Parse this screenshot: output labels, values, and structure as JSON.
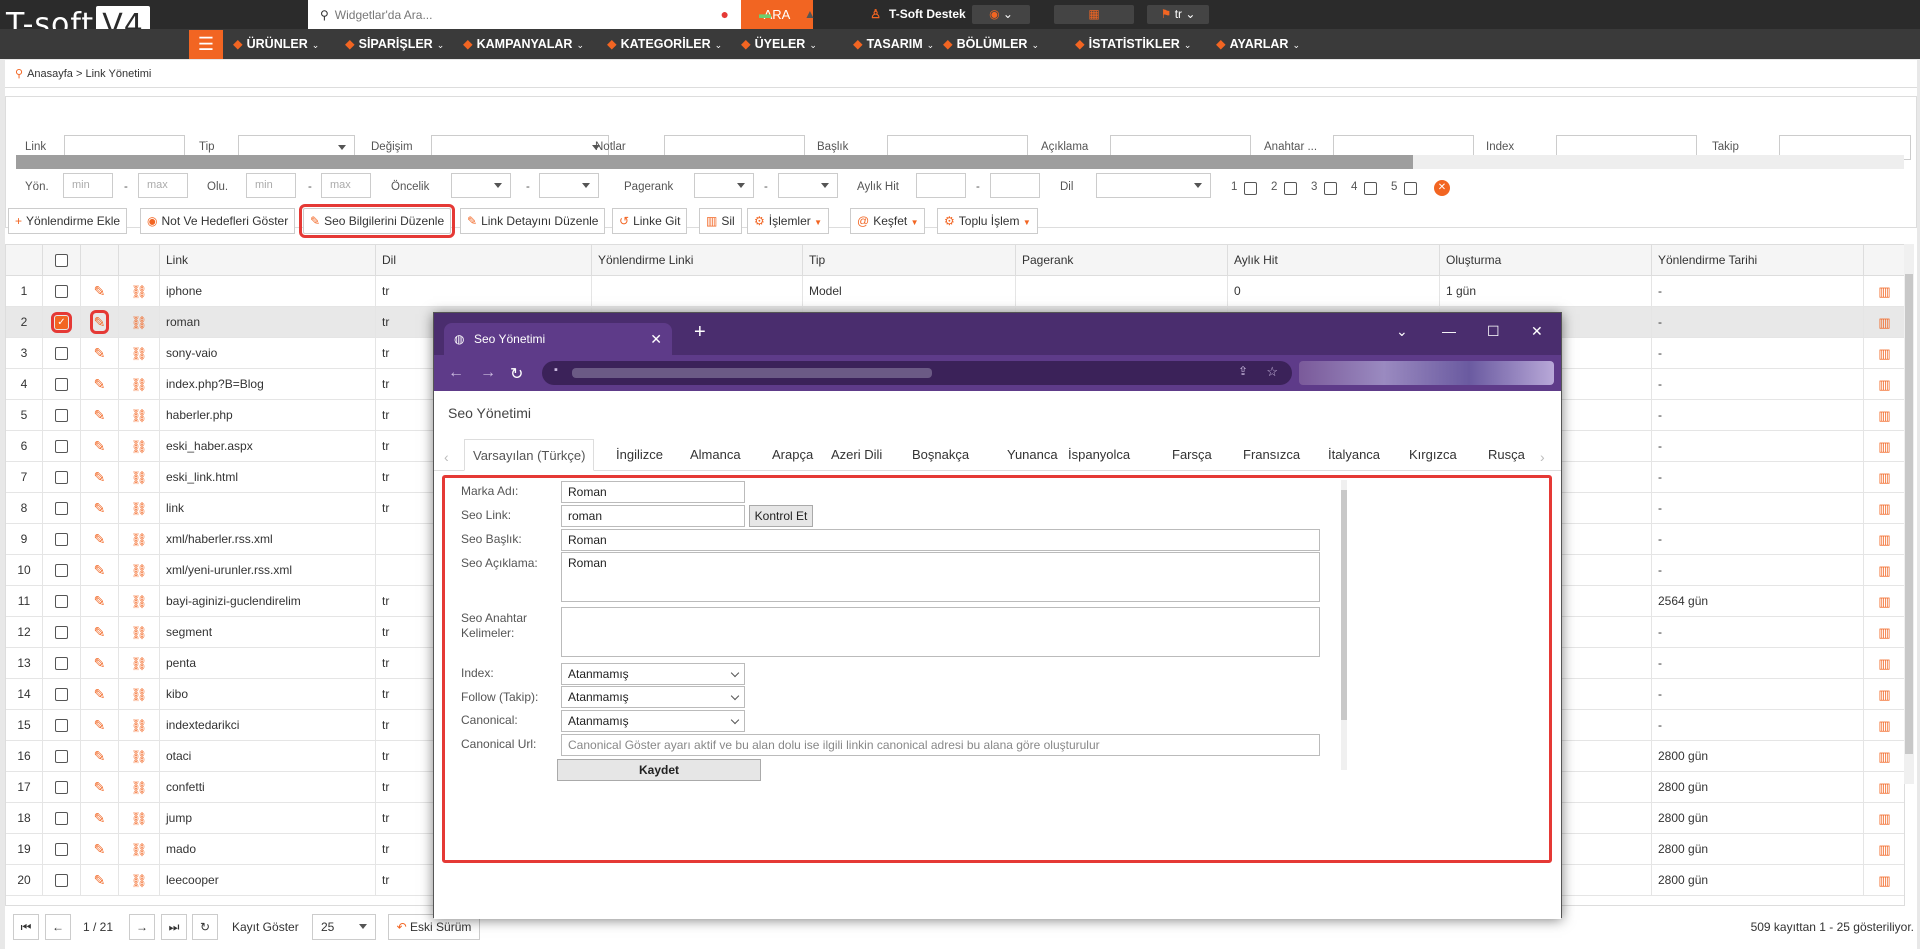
{
  "topbar": {
    "logo_text": "T-soft",
    "logo_badge": "V4",
    "search_placeholder": "Widgetlar'da Ara...",
    "search_button": "ARA",
    "support_label": "T-Soft Destek",
    "language": "tr"
  },
  "nav": {
    "items": [
      {
        "label": "ÜRÜNLER",
        "icon": "box-icon"
      },
      {
        "label": "SİPARİŞLER",
        "icon": "cart-icon"
      },
      {
        "label": "KAMPANYALAR",
        "icon": "tag-icon"
      },
      {
        "label": "KATEGORİLER",
        "icon": "sitemap-icon"
      },
      {
        "label": "ÜYELER",
        "icon": "users-icon"
      },
      {
        "label": "TASARIM",
        "icon": "brush-icon"
      },
      {
        "label": "BÖLÜMLER",
        "icon": "layers-icon"
      },
      {
        "label": "İSTATİSTİKLER",
        "icon": "chart-icon"
      },
      {
        "label": "AYARLAR",
        "icon": "settings-icon"
      }
    ]
  },
  "breadcrumb": "Anasayfa > Link Yönetimi",
  "filters": {
    "row1": [
      "Link",
      "Tip",
      "Değişim",
      "Notlar",
      "Başlık",
      "Açıklama",
      "Anahtar ...",
      "Index",
      "Takip"
    ],
    "row2": {
      "yon": "Yön.",
      "olu": "Olu.",
      "oncelik": "Öncelik",
      "pagerank": "Pagerank",
      "aylik_hit": "Aylık Hit",
      "dil": "Dil",
      "min": "min",
      "max": "max",
      "dash": "-",
      "checks": [
        "1",
        "2",
        "3",
        "4",
        "5"
      ]
    },
    "progress": 0.74
  },
  "toolbar": {
    "yonlendirme_ekle": "Yönlendirme Ekle",
    "not_goster": "Not Ve Hedefleri Göster",
    "seo_duzenle": "Seo Bilgilerini Düzenle",
    "link_detay": "Link Detayını Düzenle",
    "linke_git": "Linke Git",
    "sil": "Sil",
    "islemler": "İşlemler",
    "kesfet": "Keşfet",
    "toplu_islem": "Toplu İşlem"
  },
  "table": {
    "headers": [
      "Link",
      "Dil",
      "Yönlendirme Linki",
      "Tip",
      "Pagerank",
      "Aylık Hit",
      "Oluşturma",
      "Yönlendirme Tarihi"
    ],
    "rows": [
      {
        "n": "1",
        "link": "iphone",
        "dil": "tr",
        "tip": "Model",
        "hit": "0",
        "olus": "1 gün",
        "ytarih": "-"
      },
      {
        "n": "2",
        "link": "roman",
        "dil": "tr",
        "tip": "",
        "hit": "",
        "olus": "",
        "ytarih": "-"
      },
      {
        "n": "3",
        "link": "sony-vaio",
        "dil": "tr",
        "tip": "",
        "hit": "",
        "olus": "",
        "ytarih": "-"
      },
      {
        "n": "4",
        "link": "index.php?B=Blog",
        "dil": "tr",
        "tip": "",
        "hit": "",
        "olus": "",
        "ytarih": "-"
      },
      {
        "n": "5",
        "link": "haberler.php",
        "dil": "tr",
        "tip": "",
        "hit": "",
        "olus": "",
        "ytarih": "-"
      },
      {
        "n": "6",
        "link": "eski_haber.aspx",
        "dil": "tr",
        "tip": "",
        "hit": "",
        "olus": "",
        "ytarih": "-"
      },
      {
        "n": "7",
        "link": "eski_link.html",
        "dil": "tr",
        "tip": "",
        "hit": "",
        "olus": "",
        "ytarih": "-"
      },
      {
        "n": "8",
        "link": "link",
        "dil": "tr",
        "tip": "",
        "hit": "",
        "olus": "",
        "ytarih": "-"
      },
      {
        "n": "9",
        "link": "xml/haberler.rss.xml",
        "dil": "",
        "tip": "",
        "hit": "",
        "olus": "",
        "ytarih": "-"
      },
      {
        "n": "10",
        "link": "xml/yeni-urunler.rss.xml",
        "dil": "",
        "tip": "",
        "hit": "",
        "olus": "",
        "ytarih": "-"
      },
      {
        "n": "11",
        "link": "bayi-aginizi-guclendirelim",
        "dil": "tr",
        "tip": "",
        "hit": "",
        "olus": "",
        "ytarih": "2564 gün"
      },
      {
        "n": "12",
        "link": "segment",
        "dil": "tr",
        "tip": "",
        "hit": "",
        "olus": "",
        "ytarih": "-"
      },
      {
        "n": "13",
        "link": "penta",
        "dil": "tr",
        "tip": "",
        "hit": "",
        "olus": "",
        "ytarih": "-"
      },
      {
        "n": "14",
        "link": "kibo",
        "dil": "tr",
        "tip": "",
        "hit": "",
        "olus": "",
        "ytarih": "-"
      },
      {
        "n": "15",
        "link": "indextedarikci",
        "dil": "tr",
        "tip": "",
        "hit": "",
        "olus": "",
        "ytarih": "-"
      },
      {
        "n": "16",
        "link": "otaci",
        "dil": "tr",
        "tip": "",
        "hit": "",
        "olus": "",
        "ytarih": "2800 gün"
      },
      {
        "n": "17",
        "link": "confetti",
        "dil": "tr",
        "tip": "",
        "hit": "",
        "olus": "",
        "ytarih": "2800 gün"
      },
      {
        "n": "18",
        "link": "jump",
        "dil": "tr",
        "tip": "",
        "hit": "",
        "olus": "",
        "ytarih": "2800 gün"
      },
      {
        "n": "19",
        "link": "mado",
        "dil": "tr",
        "tip": "",
        "hit": "",
        "olus": "",
        "ytarih": "2800 gün"
      },
      {
        "n": "20",
        "link": "leecooper",
        "dil": "tr",
        "tip": "",
        "hit": "",
        "olus": "",
        "ytarih": "2800 gün"
      }
    ]
  },
  "footer": {
    "page": "1 / 21",
    "kayit_goster": "Kayıt Göster",
    "per_page": "25",
    "eski_surum": "Eski Sürüm",
    "summary": "509 kayıttan 1 - 25 gösteriliyor."
  },
  "popup": {
    "tab_title": "Seo Yönetimi",
    "heading": "Seo Yönetimi",
    "languages": [
      "Varsayılan (Türkçe)",
      "İngilizce",
      "Almanca",
      "Arapça",
      "Azeri Dili",
      "Boşnakça",
      "Yunanca",
      "İspanyolca",
      "Farsça",
      "Fransızca",
      "İtalyanca",
      "Kırgızca",
      "Rusça"
    ],
    "form": {
      "marka_label": "Marka Adı:",
      "marka_value": "Roman",
      "seo_link_label": "Seo Link:",
      "seo_link_value": "roman",
      "kontrol_btn": "Kontrol Et",
      "baslik_label": "Seo Başlık:",
      "baslik_value": "Roman",
      "aciklama_label": "Seo Açıklama:",
      "aciklama_value": "Roman",
      "anahtar_label": "Seo Anahtar Kelimeler:",
      "anahtar_value": "",
      "index_label": "Index:",
      "index_value": "Atanmamış",
      "follow_label": "Follow (Takip):",
      "follow_value": "Atanmamış",
      "canonical_label": "Canonical:",
      "canonical_value": "Atanmamış",
      "canonical_url_label": "Canonical Url:",
      "canonical_url_placeholder": "Canonical Göster ayarı aktif ve bu alan dolu ise ilgili linkin canonical adresi bu alana göre oluşturulur",
      "save": "Kaydet"
    }
  },
  "colors": {
    "accent": "#f26522",
    "highlight": "#e53935",
    "browser": "#4a2d6e"
  }
}
